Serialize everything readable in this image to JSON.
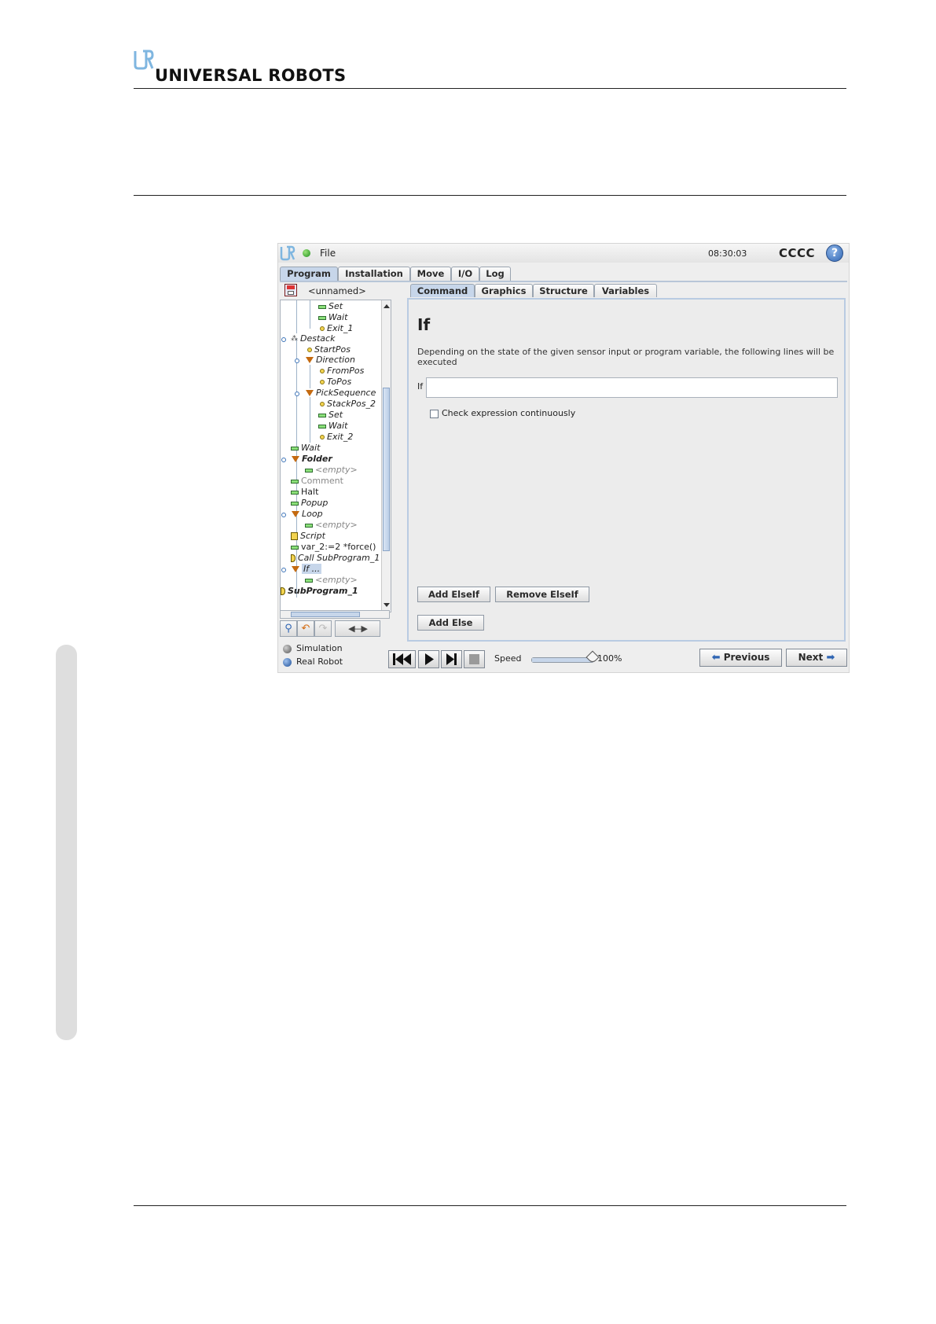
{
  "header": {
    "brand": "UNIVERSAL ROBOTS"
  },
  "app": {
    "file_menu": "File",
    "clock": "08:30:03",
    "robot_name": "CCCC",
    "help": "?",
    "main_tabs": [
      "Program",
      "Installation",
      "Move",
      "I/O",
      "Log"
    ],
    "program_name": "<unnamed>",
    "tree": [
      {
        "label": "Set"
      },
      {
        "label": "Wait"
      },
      {
        "label": "Exit_1"
      },
      {
        "label": "Destack"
      },
      {
        "label": "StartPos"
      },
      {
        "label": "Direction"
      },
      {
        "label": "FromPos"
      },
      {
        "label": "ToPos"
      },
      {
        "label": "PickSequence"
      },
      {
        "label": "StackPos_2"
      },
      {
        "label": "Set"
      },
      {
        "label": "Wait"
      },
      {
        "label": "Exit_2"
      },
      {
        "label": "Wait"
      },
      {
        "label": "Folder"
      },
      {
        "label": "<empty>"
      },
      {
        "label": "Comment"
      },
      {
        "label": "Halt"
      },
      {
        "label": "Popup"
      },
      {
        "label": "Loop"
      },
      {
        "label": "<empty>"
      },
      {
        "label": "Script"
      },
      {
        "label": "var_2:=2 *force()"
      },
      {
        "label": "Call SubProgram_1"
      },
      {
        "label": "If ..."
      },
      {
        "label": "<empty>"
      },
      {
        "label": "SubProgram_1"
      }
    ],
    "tree_tools": {
      "nav": "◀---▶"
    },
    "modes": [
      "Simulation",
      "Real Robot"
    ],
    "sub_tabs": [
      "Command",
      "Graphics",
      "Structure",
      "Variables"
    ],
    "panel": {
      "title": "If",
      "description": "Depending on the state of the given sensor input or program variable, the following lines will be executed",
      "if_label": "If",
      "if_value": "",
      "checkbox_label": "Check expression continuously",
      "add_elseif": "Add ElseIf",
      "remove_elseif": "Remove ElseIf",
      "add_else": "Add Else"
    },
    "speed_label": "Speed",
    "speed_value": "100%",
    "speed_fraction": 1.0,
    "previous": "Previous",
    "next": "Next"
  }
}
